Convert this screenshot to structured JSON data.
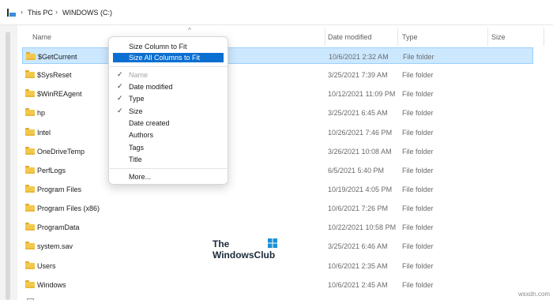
{
  "address": {
    "crumbs": [
      "This PC",
      "WINDOWS (C:)"
    ]
  },
  "columns": [
    "Name",
    "Date modified",
    "Type",
    "Size"
  ],
  "rows": [
    {
      "name": "$GetCurrent",
      "date": "10/6/2021 2:32 AM",
      "type": "File folder",
      "icon": "folder-icon"
    },
    {
      "name": "$SysReset",
      "date": "3/25/2021 7:39 AM",
      "type": "File folder",
      "icon": "folder-icon"
    },
    {
      "name": "$WinREAgent",
      "date": "10/12/2021 11:09 PM",
      "type": "File folder",
      "icon": "folder-icon"
    },
    {
      "name": "hp",
      "date": "3/25/2021 6:45 AM",
      "type": "File folder",
      "icon": "folder-icon"
    },
    {
      "name": "Intel",
      "date": "10/26/2021 7:46 PM",
      "type": "File folder",
      "icon": "folder-icon"
    },
    {
      "name": "OneDriveTemp",
      "date": "3/26/2021 10:08 AM",
      "type": "File folder",
      "icon": "folder-icon"
    },
    {
      "name": "PerfLogs",
      "date": "6/5/2021 5:40 PM",
      "type": "File folder",
      "icon": "folder-icon"
    },
    {
      "name": "Program Files",
      "date": "10/19/2021 4:05 PM",
      "type": "File folder",
      "icon": "folder-icon"
    },
    {
      "name": "Program Files (x86)",
      "date": "10/6/2021 7:26 PM",
      "type": "File folder",
      "icon": "folder-icon"
    },
    {
      "name": "ProgramData",
      "date": "10/22/2021 10:58 PM",
      "type": "File folder",
      "icon": "folder-icon"
    },
    {
      "name": "system.sav",
      "date": "3/25/2021 6:46 AM",
      "type": "File folder",
      "icon": "folder-icon"
    },
    {
      "name": "Users",
      "date": "10/6/2021 2:35 AM",
      "type": "File folder",
      "icon": "folder-icon"
    },
    {
      "name": "Windows",
      "date": "10/6/2021 2:45 AM",
      "type": "File folder",
      "icon": "folder-icon"
    }
  ],
  "selected_row": 0,
  "menu": {
    "items": [
      {
        "label": "Size Column to Fit",
        "checked": false,
        "disabled": false,
        "highlighted": false
      },
      {
        "label": "Size All Columns to Fit",
        "checked": false,
        "disabled": false,
        "highlighted": true
      },
      {
        "label": "Name",
        "checked": true,
        "disabled": true,
        "highlighted": false
      },
      {
        "label": "Date modified",
        "checked": true,
        "disabled": false,
        "highlighted": false
      },
      {
        "label": "Type",
        "checked": true,
        "disabled": false,
        "highlighted": false
      },
      {
        "label": "Size",
        "checked": true,
        "disabled": false,
        "highlighted": false
      },
      {
        "label": "Date created",
        "checked": false,
        "disabled": false,
        "highlighted": false
      },
      {
        "label": "Authors",
        "checked": false,
        "disabled": false,
        "highlighted": false
      },
      {
        "label": "Tags",
        "checked": false,
        "disabled": false,
        "highlighted": false
      },
      {
        "label": "Title",
        "checked": false,
        "disabled": false,
        "highlighted": false
      },
      {
        "label": "More...",
        "checked": false,
        "disabled": false,
        "highlighted": false
      }
    ]
  },
  "watermark": {
    "line1": "The",
    "line2": "WindowsClub"
  },
  "credit": "wsxdn.com",
  "colors": {
    "selection": "#cce8ff",
    "menu_highlight": "#0b6fd1",
    "folder": "#f2c94c"
  }
}
